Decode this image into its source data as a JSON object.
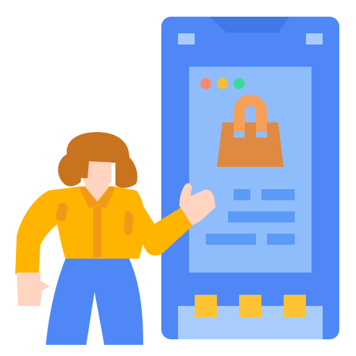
{
  "illustration": {
    "subject": "online-shopping",
    "icon": "shopping-bag-icon"
  },
  "colors": {
    "phone_body": "#4F88F6",
    "phone_notch": "#3F78E8",
    "phone_screen": "#8FBDFB",
    "phone_bottom_panel": "#A8CDFB",
    "ui_bar": "#5C9AF8",
    "dot_red": "#F58A6E",
    "dot_yellow": "#F7BF35",
    "dot_green": "#3ED99A",
    "bag_body": "#DE8A42",
    "bag_handle": "#F4A05A",
    "nav_buttons": "#FFC233",
    "hair": "#C8741E",
    "skin": "#FFD4C0",
    "shirt": "#FFB400",
    "shirt_shade": "#F29A17",
    "pants": "#4F88F6"
  }
}
